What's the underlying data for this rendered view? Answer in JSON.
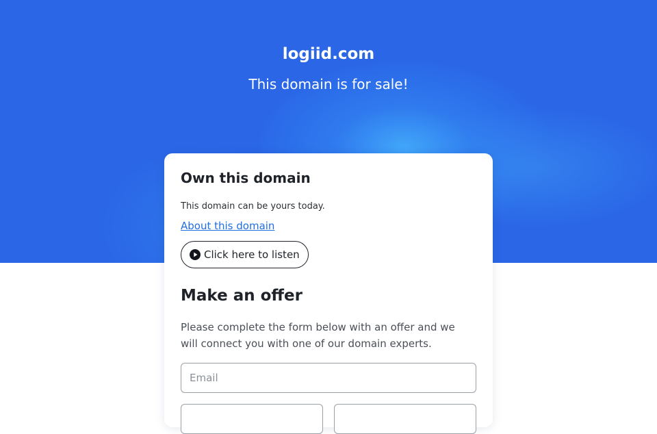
{
  "hero": {
    "domain": "logiid.com",
    "tagline": "This domain is for sale!"
  },
  "own": {
    "title": "Own this domain",
    "text": "This domain can be yours today.",
    "about_link": "About this domain",
    "listen_label": "Click here to listen",
    "listen_icon": "play-icon"
  },
  "offer": {
    "title": "Make an offer",
    "description": "Please complete the form below with an offer and we will connect you with one of our domain experts.",
    "email_placeholder": "Email"
  },
  "colors": {
    "hero_blue": "#2a66e6",
    "link_blue": "#1f6fe0"
  }
}
